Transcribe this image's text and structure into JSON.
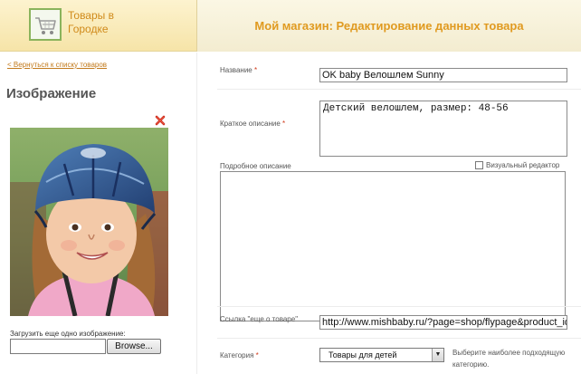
{
  "header": {
    "logo_line1": "Товары в",
    "logo_line2": "Городке",
    "title": "Мой магазин: Редактирование данных товара"
  },
  "sidebar": {
    "back_link": "< Вернуться к списку товаров",
    "image_heading": "Изображение",
    "upload_label": "Загрузить еще одно изображение:",
    "upload_value": "",
    "browse_label": "Browse..."
  },
  "form": {
    "name": {
      "label": "Название",
      "required": "*",
      "value": "OK baby Велошлем Sunny"
    },
    "short_description": {
      "label": "Краткое описание",
      "required": "*",
      "value": "Детский велошлем, размер: 48-56"
    },
    "full_description": {
      "label": "Подробное описание",
      "value": ""
    },
    "visual_editor": {
      "label": "Визуальный редактор",
      "checked": false
    },
    "more_link": {
      "label": "Ссылка \"еще о товаре\"",
      "value": "http://www.mishbaby.ru/?page=shop/flypage&product_id"
    },
    "category": {
      "label": "Категория",
      "required": "*",
      "selected": "Товары для детей",
      "hint": "Выберите наиболее подходящую категорию."
    }
  },
  "colors": {
    "accent": "#e09a20",
    "link": "#c27a1c",
    "required": "#d03a1a",
    "header_bg": "#fdf3cf"
  },
  "icons": [
    "cart-icon",
    "delete-icon",
    "chevron-down-icon"
  ]
}
